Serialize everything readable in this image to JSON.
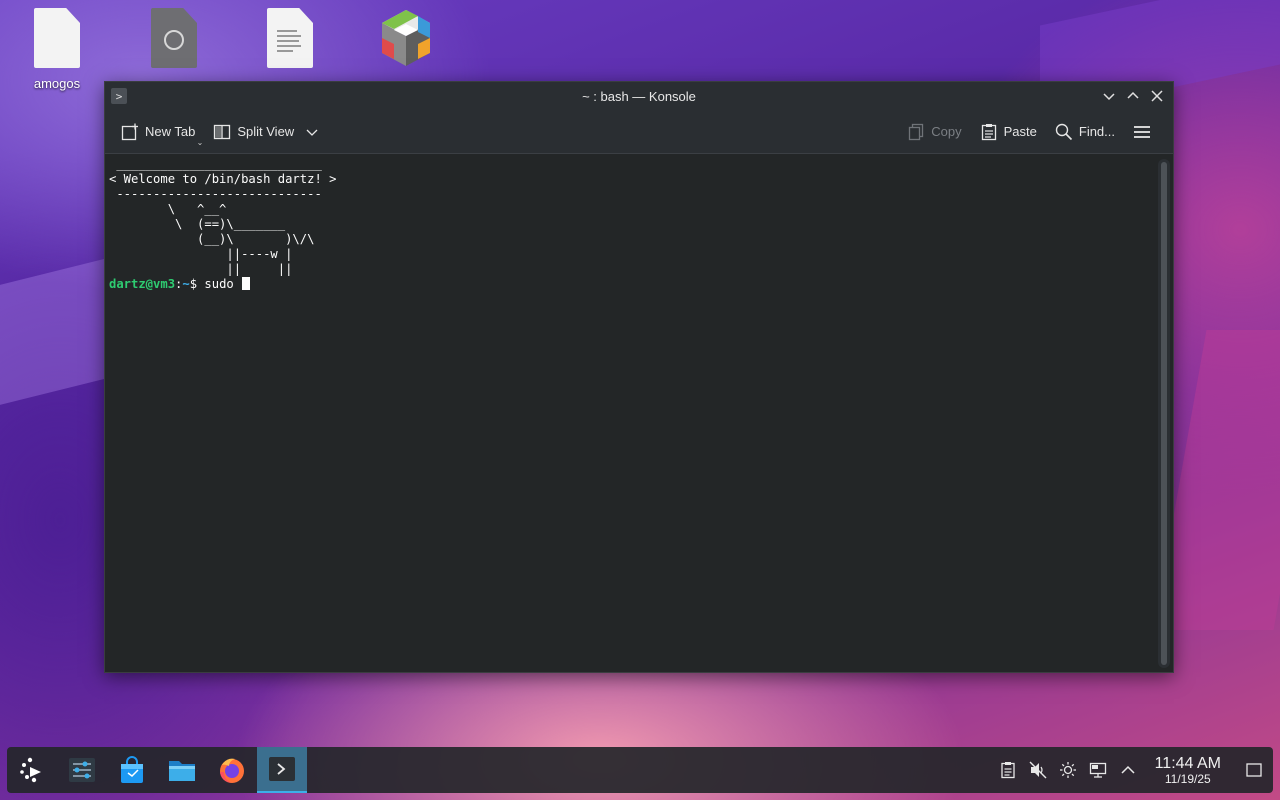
{
  "desktop": {
    "icons": [
      {
        "label": "amogos",
        "icon": "blank-file-icon"
      },
      {
        "label": "",
        "icon": "disc-image-file-icon"
      },
      {
        "label": "",
        "icon": "text-document-icon"
      },
      {
        "label": "",
        "icon": "cube-package-icon"
      }
    ]
  },
  "window": {
    "title": "~ : bash — Konsole",
    "toolbar": {
      "new_tab": "New Tab",
      "split_view": "Split View",
      "copy": "Copy",
      "paste": "Paste",
      "find": "Find..."
    }
  },
  "terminal": {
    "lines": [
      " ____________________________",
      "< Welcome to /bin/bash dartz! >",
      " ----------------------------",
      "        \\   ^__^",
      "         \\  (==)\\_______",
      "            (__)\\       )\\/\\",
      "                ||----w |",
      "                ||     ||"
    ],
    "prompt_user": "dartz@vm3",
    "prompt_sep": ":",
    "prompt_path": "~",
    "prompt_symbol": "$ ",
    "command": "sudo "
  },
  "taskbar": {
    "items": [
      {
        "name": "application-launcher",
        "icon": "kde-launcher-icon"
      },
      {
        "name": "system-settings",
        "icon": "settings-sliders-icon"
      },
      {
        "name": "discover",
        "icon": "store-bag-icon"
      },
      {
        "name": "dolphin",
        "icon": "folder-icon"
      },
      {
        "name": "firefox",
        "icon": "firefox-icon"
      },
      {
        "name": "konsole",
        "icon": "terminal-icon"
      }
    ],
    "clock": {
      "time": "11:44 AM",
      "date": "11/19/25"
    }
  }
}
